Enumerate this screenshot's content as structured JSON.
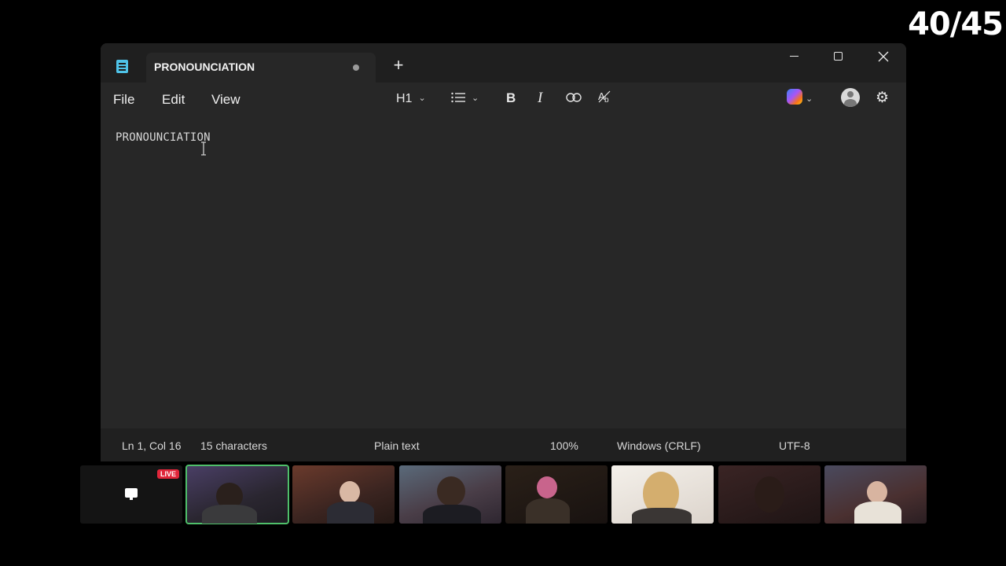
{
  "overlay": {
    "counter": "40/45"
  },
  "window": {
    "tab_title": "PRONOUNCIATION",
    "menus": [
      "File",
      "Edit",
      "View"
    ],
    "toolbar": {
      "heading": "H1",
      "bold": "B",
      "italic": "I"
    },
    "editor_text": "PRONOUNCIATION",
    "status": {
      "position": "Ln 1, Col 16",
      "characters": "15 characters",
      "format": "Plain text",
      "zoom": "100%",
      "line_ending": "Windows (CRLF)",
      "encoding": "UTF-8"
    }
  },
  "call": {
    "live_label": "LIVE",
    "tiles": [
      {
        "kind": "screen-share",
        "bg": "#141414"
      },
      {
        "kind": "camera",
        "bg": "#3a3448"
      },
      {
        "kind": "camera",
        "bg": "#4a2a24"
      },
      {
        "kind": "camera",
        "bg": "#3e3a44"
      },
      {
        "kind": "camera",
        "bg": "#1a1410"
      },
      {
        "kind": "camera",
        "bg": "#e8e2da"
      },
      {
        "kind": "camera",
        "bg": "#2a1c1c"
      },
      {
        "kind": "camera",
        "bg": "#4a3a40"
      }
    ]
  },
  "colors": {
    "accent_green": "#4fbf6a",
    "live_red": "#e0263a",
    "notepad_icon": "#4fc3e8"
  }
}
